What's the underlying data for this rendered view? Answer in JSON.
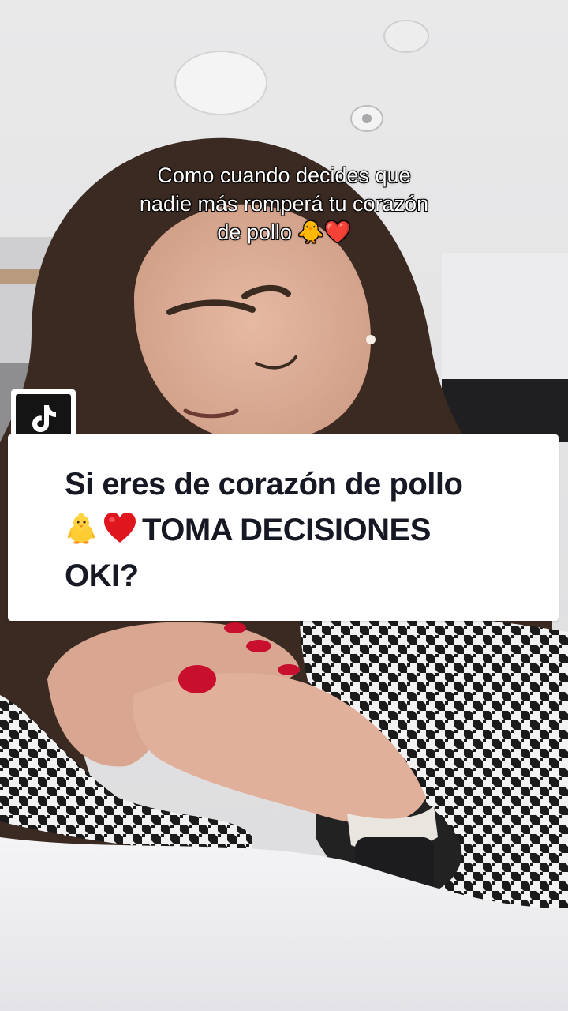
{
  "overlay_caption": {
    "line1": "Como cuando decides que",
    "line2": "nadie más romperá tu corazón",
    "line3": "de pollo 🐥❤️"
  },
  "reply_card": {
    "platform_icon": "tiktok-logo-icon",
    "line1": "Si eres de corazón de pollo",
    "line2_emojis": [
      "chick-emoji",
      "red-heart-emoji"
    ],
    "line2_text": "TOMA DECISIONES",
    "line3": "OKI?"
  },
  "colors": {
    "card_background": "#ffffff",
    "card_text": "#161823",
    "badge_background": "#141414",
    "caption_text": "#ffffff"
  }
}
